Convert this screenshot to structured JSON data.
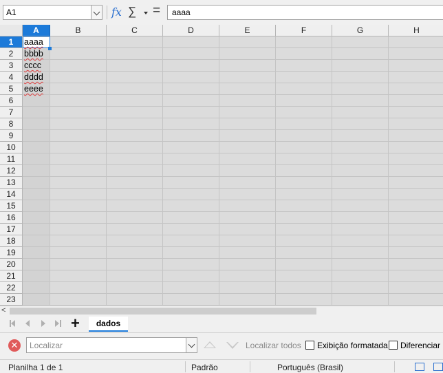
{
  "formula_bar": {
    "name_box": "A1",
    "formula_value": "aaaa",
    "fx_label": "fx",
    "sum_label": "∑",
    "equals_label": "="
  },
  "grid": {
    "columns": [
      "A",
      "B",
      "C",
      "D",
      "E",
      "F",
      "G",
      "H"
    ],
    "rows": [
      "1",
      "2",
      "3",
      "4",
      "5",
      "6",
      "7",
      "8",
      "9",
      "10",
      "11",
      "12",
      "13",
      "14",
      "15",
      "16",
      "17",
      "18",
      "19",
      "20",
      "21",
      "22",
      "23"
    ],
    "cells_col_a": [
      "aaaa",
      "bbbb",
      "cccc",
      "dddd",
      "eeee"
    ],
    "selected_column": "A",
    "selected_row": "1"
  },
  "scroll_left_label": "<",
  "sheets": {
    "add_label": "+",
    "tabs": [
      "dados"
    ]
  },
  "find": {
    "close_label": "✕",
    "placeholder": "Localizar",
    "find_all": "Localizar todos",
    "formatted_display": "Exibição formatada",
    "match_case": "Diferenciar m"
  },
  "status": {
    "sheet_position": "Planilha 1 de 1",
    "page_style": "Padrão",
    "language": "Português (Brasil)"
  },
  "colors": {
    "accent": "#1c7ad9",
    "spell_error": "#e04040"
  }
}
